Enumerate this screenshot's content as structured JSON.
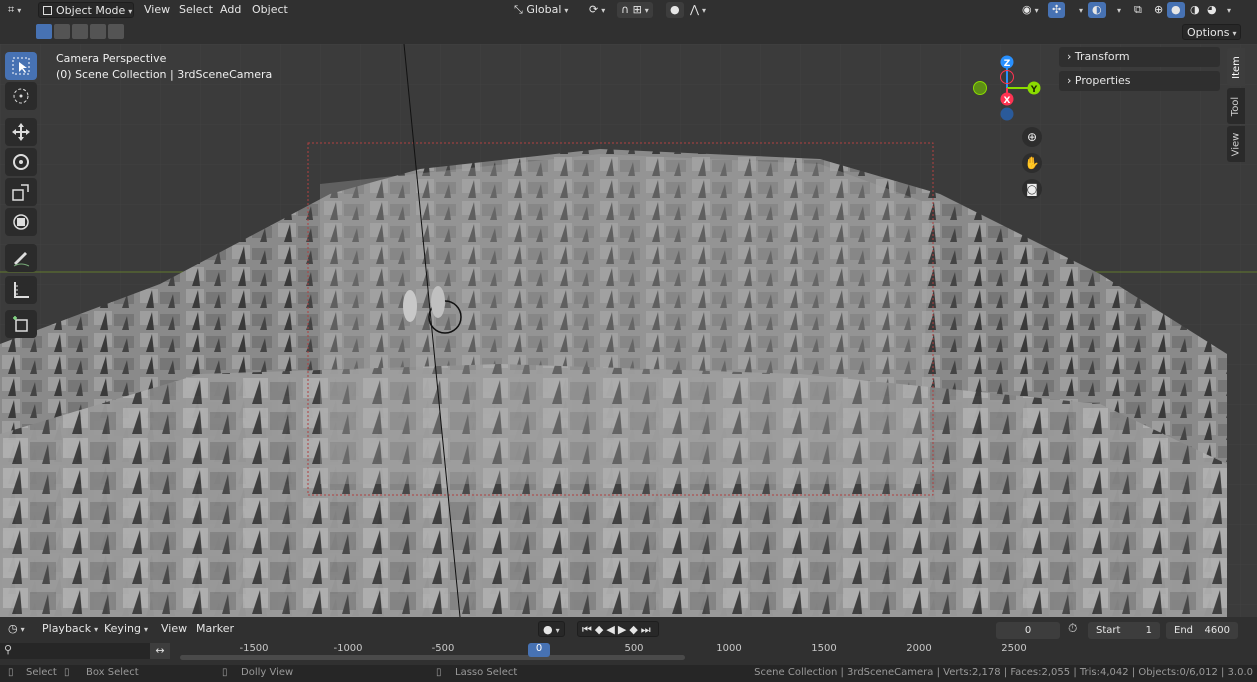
{
  "header": {
    "mode": "Object Mode",
    "menus": [
      "View",
      "Select",
      "Add",
      "Object"
    ],
    "orientation": "Global",
    "options_label": "Options"
  },
  "viewport": {
    "title": "Camera Perspective",
    "subtitle": "(0) Scene Collection | 3rdSceneCamera"
  },
  "gizmo": {
    "z": "Z",
    "x": "X",
    "y": "Y"
  },
  "npanel": {
    "transform": "Transform",
    "properties": "Properties",
    "tabs": [
      "Item",
      "Tool",
      "View"
    ]
  },
  "timeline": {
    "menus": [
      "Playback",
      "Keying",
      "View",
      "Marker"
    ],
    "current_frame": "0",
    "start_label": "Start",
    "start_value": "1",
    "end_label": "End",
    "end_value": "4600",
    "ticks": [
      "-1500",
      "-1000",
      "-500",
      "0",
      "500",
      "1000",
      "1500",
      "2000",
      "2500"
    ]
  },
  "status": {
    "select": "Select",
    "box_select": "Box Select",
    "dolly": "Dolly View",
    "lasso": "Lasso Select",
    "info": "Scene Collection | 3rdSceneCamera | Verts:2,178 | Faces:2,055 | Tris:4,042 | Objects:0/6,012 | 3.0.0"
  },
  "colors": {
    "accent": "#4772b3",
    "x_axis": "#ff3352",
    "y_axis": "#8bdc00",
    "z_axis": "#2890ff",
    "playhead": "#4772b3"
  }
}
